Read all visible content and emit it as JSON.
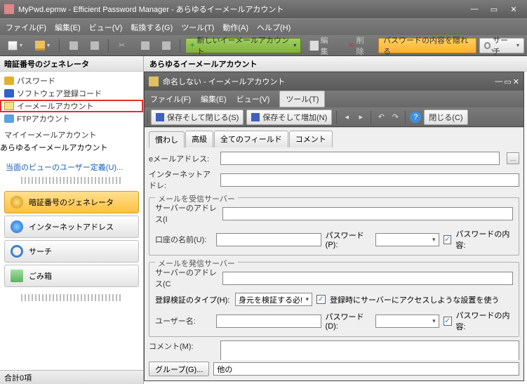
{
  "window": {
    "title": "MyPwd.epmw - Efficient Password Manager - あらゆるイーメールアカウント"
  },
  "menu": {
    "file": "ファイル(F)",
    "edit": "編集(E)",
    "view": "ビュー(V)",
    "convert": "転換する(G)",
    "tools": "ツール(T)",
    "action": "動作(A)",
    "help": "ヘルプ(H)"
  },
  "toolbar": {
    "new_account": "新しいイーメールアカウント",
    "edit": "編集",
    "delete": "削除",
    "hide_pwd": "パスワードの内容を隠れる",
    "search": "サーチ"
  },
  "sidebar": {
    "header": "暗証番号のジェネレータ",
    "items": [
      "パスワード",
      "ソフトウェア登録コード",
      "イーメールアカウント",
      "FTPアカウント"
    ],
    "subhead": "マイイーメールアカウント",
    "subitem": "あらゆるイーメールアカウント",
    "userdef": "当面のビューのユーザー定義(U)...",
    "nav": [
      "暗証番号のジェネレータ",
      "インターネットアドレス",
      "サーチ",
      "ごみ箱"
    ],
    "status": "合計0項"
  },
  "right": {
    "header": "あらゆるイーメールアカウント"
  },
  "dialog": {
    "title": "命名しない - イーメールアカウント",
    "menu": {
      "file": "ファイル(F)",
      "edit": "編集(E)",
      "view": "ビュー(V)",
      "tool": "ツール(T)"
    },
    "tool": {
      "save_close": "保存そして閉じる(S)",
      "save_add": "保存そして増加(N)",
      "close": "閉じる(C)"
    },
    "tabs": [
      "慣わし",
      "高級",
      "全てのフィールド",
      "コメント"
    ],
    "form": {
      "email_label": "eメールアドレス:",
      "internet_label": "インターネットアドレ:",
      "recv_group": "メールを受信サーバー",
      "server_addr_i": "サーバーのアドレス(I",
      "account_name": "口座の名前(U):",
      "password_p": "パスワード(P):",
      "pwd_content": "パスワードの内容:",
      "send_group": "メールを発信サーバー",
      "server_addr_o": "サーバーのアドレス(C",
      "auth_type": "登録検証のタイプ(H):",
      "auth_value": "身元を検証する必!",
      "access_on_reg": "登録時にサーバーにアクセスしような設置を使う",
      "username": "ユーザー名:",
      "password_d": "パスワード(D):",
      "comment": "コメント(M):",
      "group_btn": "グループ(G)...",
      "group_val": "他の"
    }
  }
}
